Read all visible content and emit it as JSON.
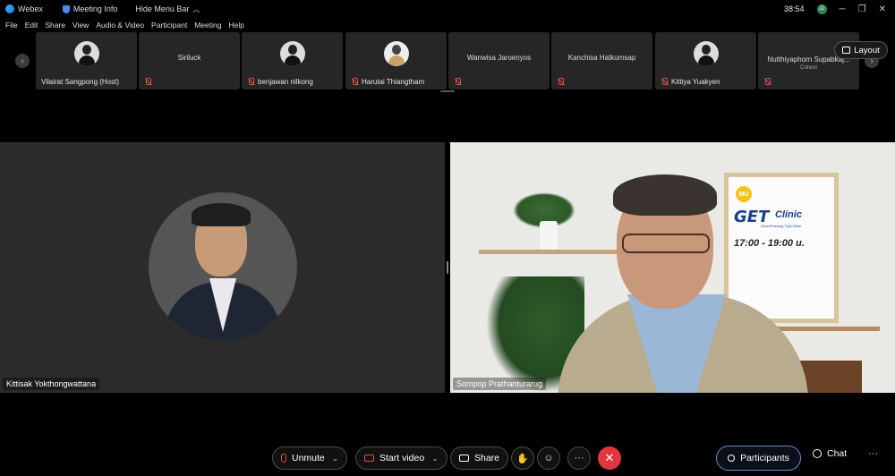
{
  "titlebar": {
    "app_name": "Webex",
    "meeting_info": "Meeting Info",
    "hide_menu_bar": "Hide Menu Bar",
    "timer": "38:54",
    "avatar_initials": "JJ",
    "minimize": "─",
    "maximize": "❐",
    "close": "✕"
  },
  "menubar": {
    "items": [
      "File",
      "Edit",
      "Share",
      "View",
      "Audio & Video",
      "Participant",
      "Meeting",
      "Help"
    ]
  },
  "strip": {
    "prev": "‹",
    "next": "›",
    "layout_label": "Layout",
    "tiles": [
      {
        "name": "Vilairat Sangpong (Host)",
        "has_photo": true,
        "muted": false
      },
      {
        "name": "Siriluck",
        "has_photo": false,
        "muted": true
      },
      {
        "name": "benjawan nilkong",
        "has_photo": true,
        "muted": true
      },
      {
        "name": "Harutai Thiangtham",
        "has_photo": true,
        "muted": true
      },
      {
        "name": "Wanwisa Jaroenyos",
        "has_photo": false,
        "muted": true
      },
      {
        "name": "Kanchisa Hatkumsap",
        "has_photo": false,
        "muted": true
      },
      {
        "name": "Kittiya Yuakyen",
        "has_photo": true,
        "muted": true
      },
      {
        "name": "Nutthiyaphorn Supabkaj...",
        "sub": "Cohost",
        "has_photo": false,
        "muted": true
      }
    ]
  },
  "main": {
    "left_name": "Kittisak Yokthongwattana",
    "right_name": "Sompop Prathanturarug",
    "poster": {
      "mu": "MU",
      "get": "GET",
      "clinic": "Clinic",
      "tagline": "Good Evening TQA Clinic",
      "time": "17:00 - 19:00 u."
    }
  },
  "controls": {
    "unmute": "Unmute",
    "start_video": "Start video",
    "share": "Share",
    "raise_hand": "✋",
    "reactions": "☺",
    "more": "···",
    "end": "✕",
    "participants": "Participants",
    "chat": "Chat",
    "more_right": "···",
    "chevron": "⌄"
  }
}
